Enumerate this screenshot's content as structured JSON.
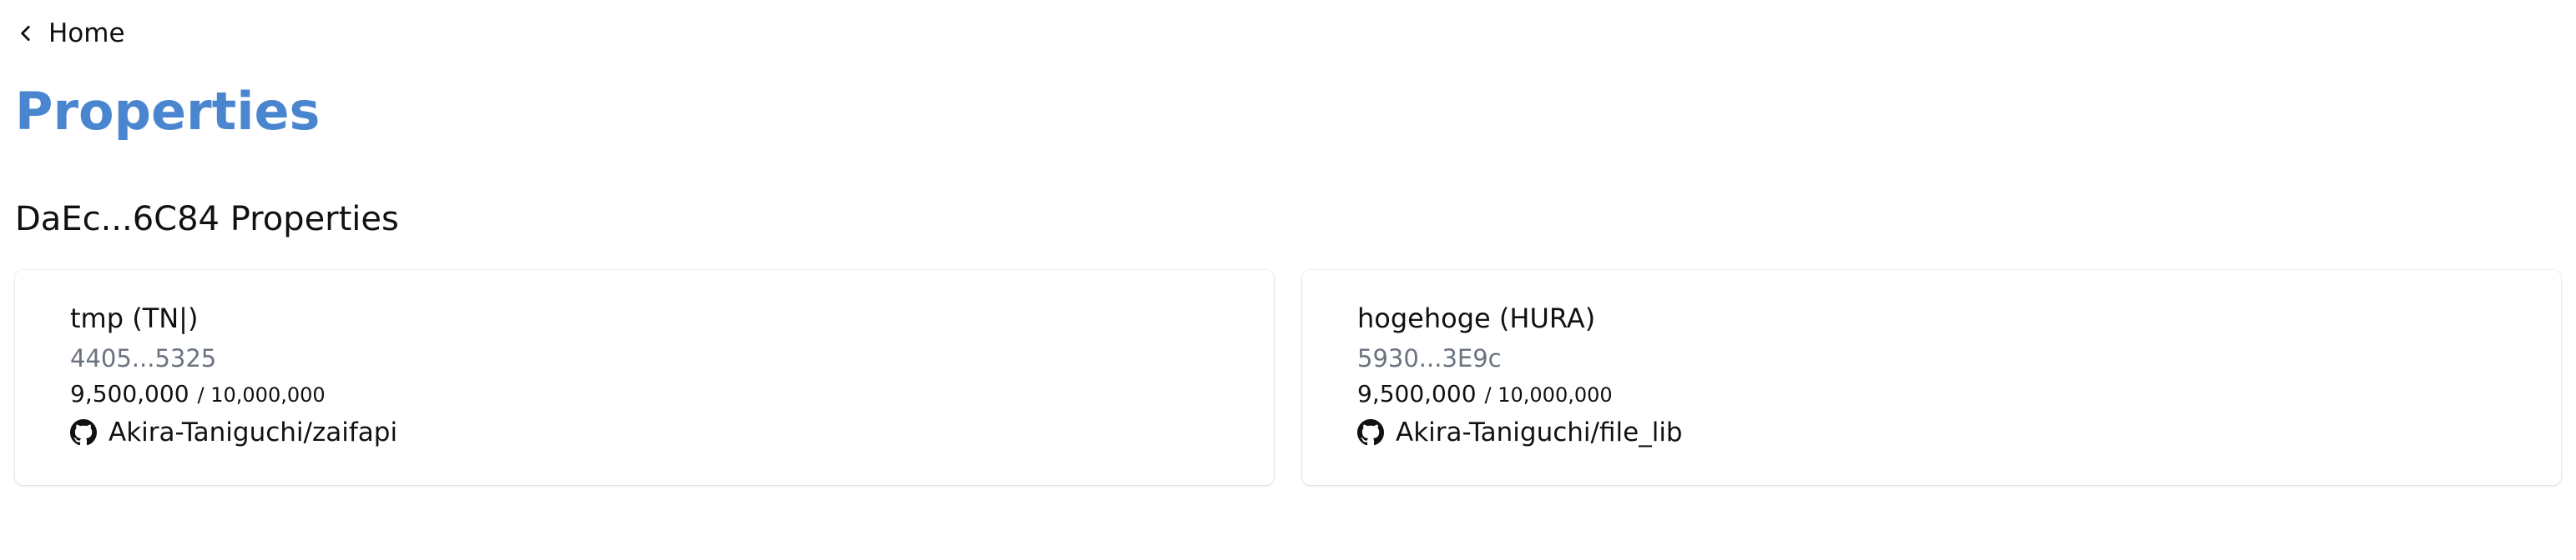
{
  "nav": {
    "back_label": "Home",
    "back_icon": "chevron-left-icon"
  },
  "page": {
    "title": "Properties",
    "title_color": "#4a86d0"
  },
  "section": {
    "title": "DaEc...6C84 Properties"
  },
  "cards": [
    {
      "name": "tmp (TN|)",
      "address": "4405...5325",
      "supply_current": "9,500,000",
      "supply_max": "/ 10,000,000",
      "repo_icon": "github-icon",
      "repo": "Akira-Taniguchi/zaifapi"
    },
    {
      "name": "hogehoge (HURA)",
      "address": "5930...3E9c",
      "supply_current": "9,500,000",
      "supply_max": "/ 10,000,000",
      "repo_icon": "github-icon",
      "repo": "Akira-Taniguchi/file_lib"
    }
  ]
}
